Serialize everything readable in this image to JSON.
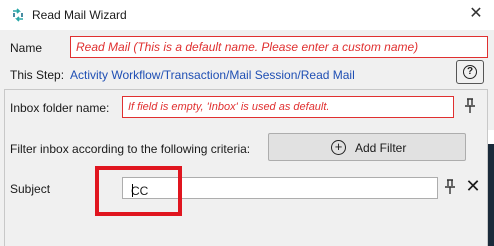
{
  "window": {
    "title": "Read Mail Wizard",
    "app_icon": "workflow-logo-icon",
    "close_icon": "close-icon",
    "close_glyph": "✕"
  },
  "form": {
    "name_label": "Name",
    "name_placeholder": "Read Mail  (This is a default name. Please enter a custom name)",
    "step_label": "This Step:",
    "step_path": "Activity Workflow/Transaction/Mail Session/Read Mail",
    "help_glyph": "?",
    "inbox_label": "Inbox folder name:",
    "inbox_placeholder": "If field is empty, 'Inbox' is used as default.",
    "filter_label": "Filter inbox according to the following criteria:",
    "add_filter_label": "Add Filter",
    "add_filter_glyph": "+",
    "subject_label": "Subject",
    "subject_value": "CC",
    "remove_glyph": "✕"
  },
  "colors": {
    "error_red": "#e03030",
    "link_blue": "#1f4fb4",
    "highlight_red": "#e0151f",
    "app_icon_teal": "#2aa7a7"
  }
}
